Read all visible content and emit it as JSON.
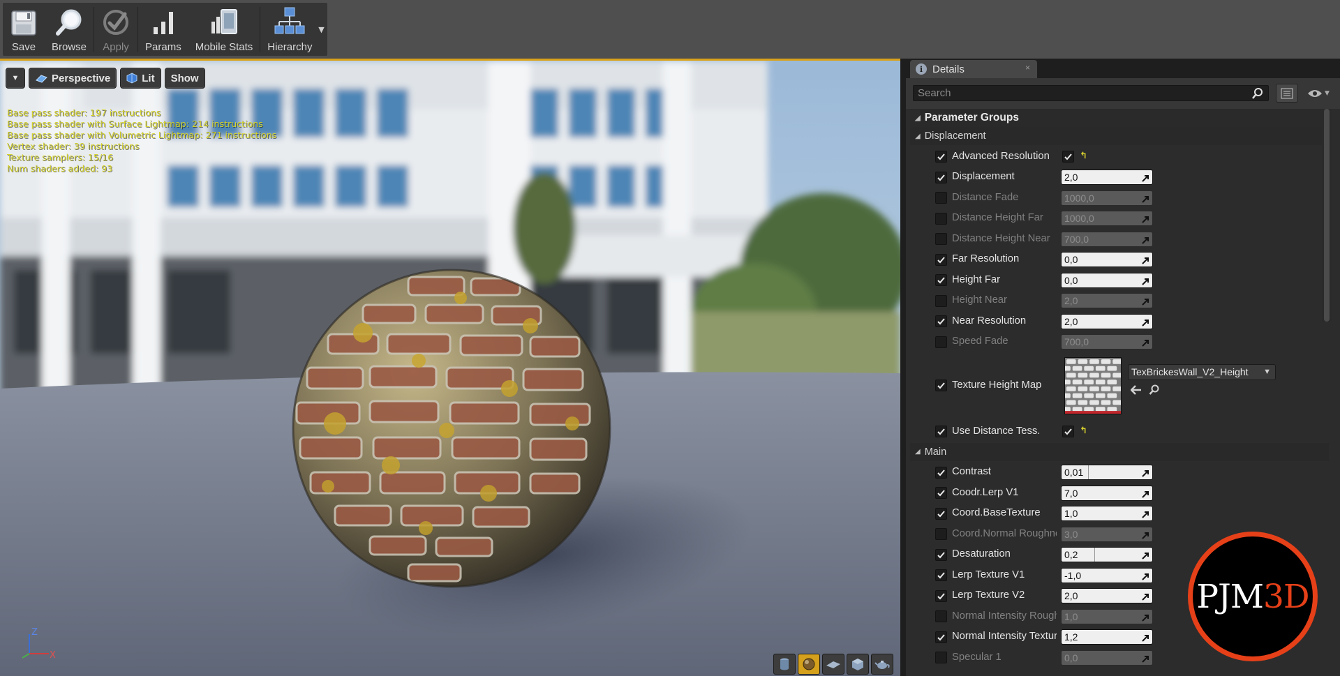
{
  "toolbar": {
    "buttons": [
      {
        "label": "Save",
        "icon": "save-icon",
        "enabled": true
      },
      {
        "label": "Browse",
        "icon": "browse-icon",
        "enabled": true
      },
      {
        "label": "Apply",
        "icon": "apply-icon",
        "enabled": false
      },
      {
        "label": "Params",
        "icon": "params-icon",
        "enabled": true
      },
      {
        "label": "Mobile Stats",
        "icon": "mobile-stats-icon",
        "enabled": true
      },
      {
        "label": "Hierarchy",
        "icon": "hierarchy-icon",
        "enabled": true
      }
    ]
  },
  "viewport": {
    "perspective_label": "Perspective",
    "lit_label": "Lit",
    "show_label": "Show",
    "stats": [
      "Base pass shader: 197 instructions",
      "Base pass shader with Surface Lightmap: 214 instructions",
      "Base pass shader with Volumetric Lightmap: 271 instructions",
      "Vertex shader: 39 instructions",
      "Texture samplers: 15/16",
      "Num shaders added: 93"
    ],
    "axis": {
      "z": "Z",
      "x": "X"
    },
    "preview_shapes": [
      "cylinder-icon",
      "sphere-icon",
      "plane-icon",
      "cube-icon",
      "teapot-icon"
    ],
    "active_shape": "sphere-icon",
    "accent_color": "#d9a21a"
  },
  "details": {
    "tab_title": "Details",
    "tab_close": "×",
    "search_placeholder": "Search",
    "group_title": "Parameter Groups",
    "displacement": {
      "title": "Displacement",
      "rows": [
        {
          "name": "Advanced Resolution",
          "enabled": true,
          "type": "bool",
          "value_checked": true,
          "reset": "↰"
        },
        {
          "name": "Displacement",
          "enabled": true,
          "type": "float",
          "value": "2,0"
        },
        {
          "name": "Distance Fade",
          "enabled": false,
          "type": "float",
          "value": "1000,0"
        },
        {
          "name": "Distance Height Far",
          "enabled": false,
          "type": "float",
          "value": "1000,0"
        },
        {
          "name": "Distance Height Near",
          "enabled": false,
          "type": "float",
          "value": "700,0"
        },
        {
          "name": "Far Resolution",
          "enabled": true,
          "type": "float",
          "value": "0,0"
        },
        {
          "name": "Height Far",
          "enabled": true,
          "type": "float",
          "value": "0,0"
        },
        {
          "name": "Height Near",
          "enabled": false,
          "type": "float",
          "value": "2,0"
        },
        {
          "name": "Near Resolution",
          "enabled": true,
          "type": "float",
          "value": "2,0"
        },
        {
          "name": "Speed Fade",
          "enabled": false,
          "type": "float",
          "value": "700,0"
        }
      ],
      "texture_row": {
        "name": "Texture Height Map",
        "enabled": true,
        "asset": "TexBrickesWall_V2_Height"
      },
      "last_row": {
        "name": "Use Distance Tess.",
        "enabled": true,
        "type": "bool",
        "value_checked": true,
        "reset": "↰"
      }
    },
    "main": {
      "title": "Main",
      "rows": [
        {
          "name": "Contrast",
          "enabled": true,
          "value": "0,01",
          "fill": 0.3
        },
        {
          "name": "Coodr.Lerp V1",
          "enabled": true,
          "value": "7,0"
        },
        {
          "name": "Coord.BaseTexture",
          "enabled": true,
          "value": "1,0"
        },
        {
          "name": "Coord.Normal Roughness",
          "enabled": false,
          "value": "3,0"
        },
        {
          "name": "Desaturation",
          "enabled": true,
          "value": "0,2",
          "fill": 0.37
        },
        {
          "name": "Lerp Texture V1",
          "enabled": true,
          "value": "-1,0"
        },
        {
          "name": "Lerp Texture V2",
          "enabled": true,
          "value": "2,0"
        },
        {
          "name": "Normal Intensity Roughness",
          "enabled": false,
          "value": "1,0"
        },
        {
          "name": "Normal Intensity Texture",
          "enabled": true,
          "value": "1,2"
        },
        {
          "name": "Specular 1",
          "enabled": false,
          "value": "0,0"
        }
      ]
    }
  },
  "logo": {
    "text_white": "PJM",
    "text_red": "3D",
    "color": "#e64019"
  }
}
